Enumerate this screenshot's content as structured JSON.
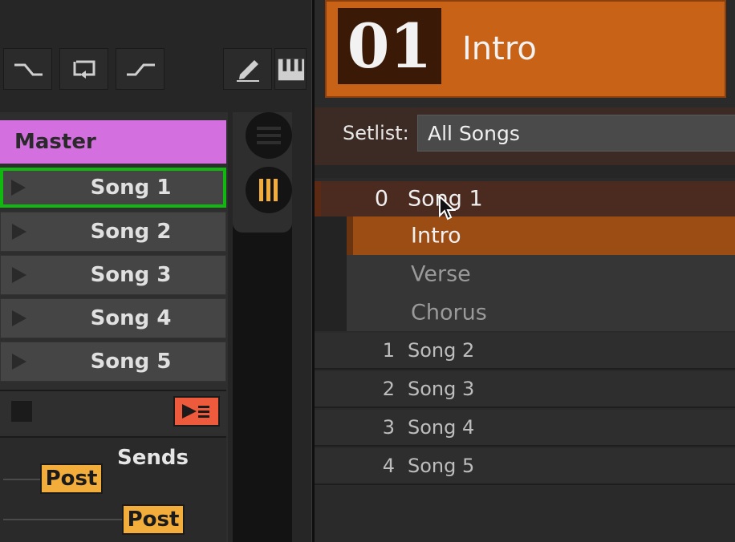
{
  "toolbar": {
    "buttons": [
      {
        "name": "fade-out-icon"
      },
      {
        "name": "loop-icon"
      },
      {
        "name": "fade-in-icon"
      },
      {
        "name": "pencil-icon"
      },
      {
        "name": "piano-icon"
      }
    ]
  },
  "tracks": {
    "master_label": "Master",
    "songs": [
      {
        "label": "Song 1",
        "selected": true
      },
      {
        "label": "Song 2"
      },
      {
        "label": "Song 3"
      },
      {
        "label": "Song 4"
      },
      {
        "label": "Song 5"
      }
    ]
  },
  "sends": {
    "label": "Sends",
    "post_a": "Post",
    "post_b": "Post"
  },
  "current": {
    "number": "01",
    "name": "Intro"
  },
  "setlist": {
    "label": "Setlist:",
    "value": "All Songs"
  },
  "song_list": {
    "expanded": {
      "index": "0",
      "name": "Song 1",
      "sections": [
        {
          "name": "Intro",
          "active": true
        },
        {
          "name": "Verse"
        },
        {
          "name": "Chorus"
        }
      ]
    },
    "others": [
      {
        "index": "1",
        "name": "Song 2"
      },
      {
        "index": "2",
        "name": "Song 3"
      },
      {
        "index": "3",
        "name": "Song 4"
      },
      {
        "index": "4",
        "name": "Song 5"
      }
    ]
  },
  "colors": {
    "master": "#d46fe0",
    "selected_outline": "#10b810",
    "accent_orange": "#c76216",
    "post_badge": "#f3ad3a",
    "launch_button": "#ee5a3c",
    "rack_toggle_active": "#f3ad3a"
  }
}
